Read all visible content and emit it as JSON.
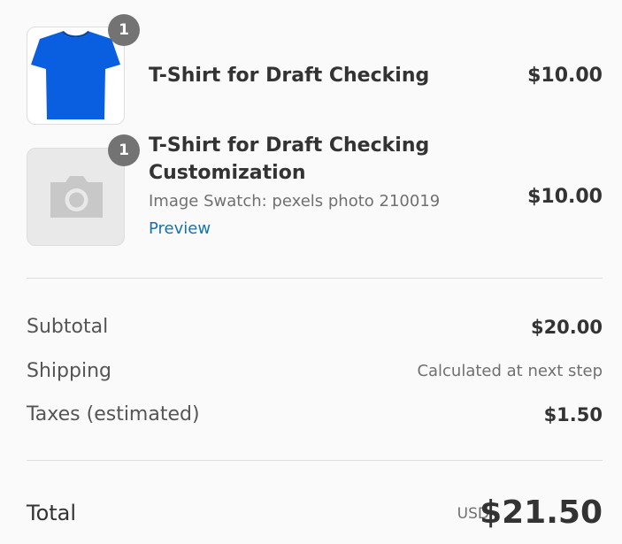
{
  "line_items": [
    {
      "quantity": "1",
      "name": "T-Shirt for Draft Checking",
      "price": "$10.00",
      "image": "blue-tshirt"
    },
    {
      "quantity": "1",
      "name_line1": "T-Shirt for Draft Checking",
      "name_line2": "Customization",
      "option": "Image Swatch: pexels photo 210019",
      "link": "Preview",
      "price": "$10.00",
      "image": "camera-placeholder-icon"
    }
  ],
  "summary": {
    "subtotal_label": "Subtotal",
    "subtotal_value": "$20.00",
    "shipping_label": "Shipping",
    "shipping_value": "Calculated at next step",
    "taxes_label": "Taxes (estimated)",
    "taxes_value": "$1.50"
  },
  "total": {
    "label": "Total",
    "currency": "USD",
    "value": "$21.50"
  },
  "colors": {
    "link": "#1773b0",
    "badge": "#737373",
    "shirt": "#0a5fe0"
  }
}
